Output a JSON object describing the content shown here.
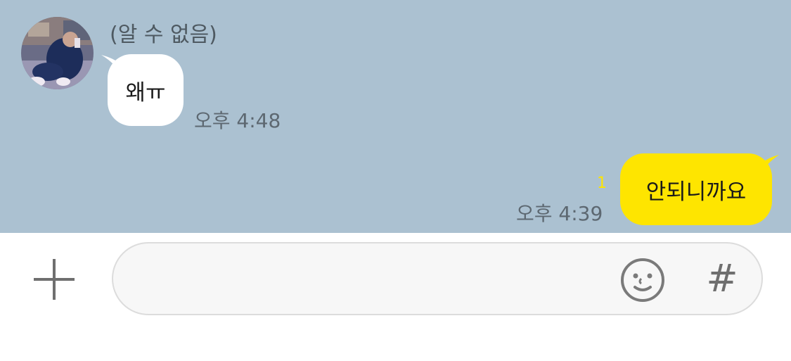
{
  "colors": {
    "chat_background": "#abc1d1",
    "incoming_bubble": "#ffffff",
    "outgoing_bubble": "#fee500",
    "unread_count": "#fee500"
  },
  "messages": {
    "incoming": {
      "sender_name": "(알 수 없음)",
      "avatar": "profile-photo",
      "text": "왜ㅠ",
      "time": "오후 4:48"
    },
    "outgoing": {
      "text": "안되니까요",
      "time": "오후 4:39",
      "unread_count": "1"
    }
  },
  "input_bar": {
    "plus_icon": "plus-icon",
    "emoji_icon": "emoji-icon",
    "hash_label": "#"
  }
}
